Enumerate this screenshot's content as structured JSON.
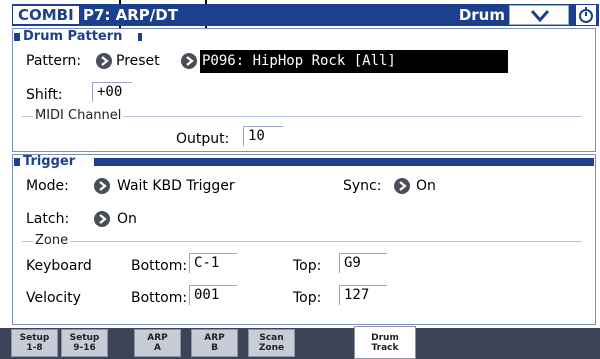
{
  "header": {
    "mode": "COMBI",
    "page": "P7: ARP/DT",
    "page_name": "Drum Track"
  },
  "drum_pattern": {
    "section_title": "Drum Pattern",
    "pattern_label": "Pattern:",
    "pattern_bank": "Preset",
    "pattern_value": "P096: HipHop Rock [All]",
    "shift_label": "Shift:",
    "shift_value": "+00",
    "midi_channel_label": "MIDI Channel",
    "output_label": "Output:",
    "output_value": "10"
  },
  "trigger": {
    "section_title": "Trigger",
    "mode_label": "Mode:",
    "mode_value": "Wait KBD Trigger",
    "sync_label": "Sync:",
    "sync_value": "On",
    "latch_label": "Latch:",
    "latch_value": "On",
    "zone_label": "Zone",
    "keyboard_label": "Keyboard",
    "velocity_label": "Velocity",
    "bottom_label": "Bottom:",
    "top_label": "Top:",
    "keyboard_bottom": "C-1",
    "keyboard_top": "G9",
    "velocity_bottom": "001",
    "velocity_top": "127"
  },
  "tabs": [
    {
      "line1": "Setup",
      "line2": "1-8"
    },
    {
      "line1": "Setup",
      "line2": "9-16"
    },
    {
      "line1": "ARP",
      "line2": "A"
    },
    {
      "line1": "ARP",
      "line2": "B"
    },
    {
      "line1": "Scan",
      "line2": "Zone"
    },
    {
      "line1": "Drum",
      "line2": "Track"
    }
  ],
  "icons": {
    "menu": "chevron-down-icon",
    "clock": "stopwatch-icon",
    "popup": "arrow-right-circle-icon"
  },
  "colors": {
    "title_bar": "#1c3f8e",
    "tab_bar": "#3c4458",
    "selected_value_bg": "#000000"
  }
}
